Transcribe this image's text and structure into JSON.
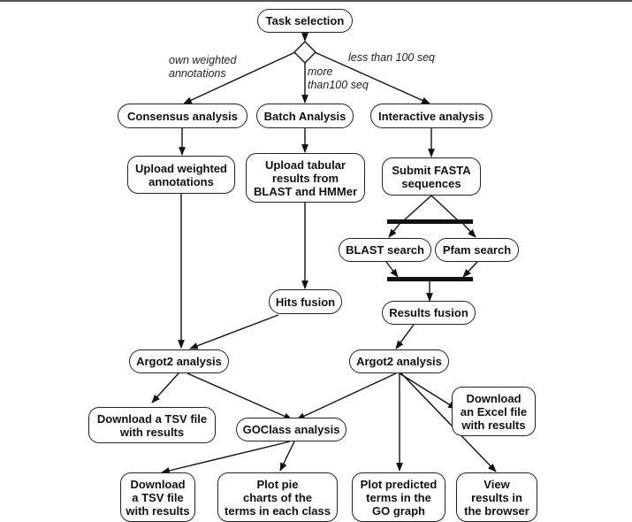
{
  "diagram": {
    "nodes": {
      "task_selection": "Task selection",
      "consensus_analysis": "Consensus analysis",
      "batch_analysis": "Batch Analysis",
      "interactive_analysis": "Interactive analysis",
      "upload_weighted": "Upload weighted\nannotations",
      "upload_tabular": "Upload tabular\nresults from\nBLAST and HMMer",
      "submit_fasta": "Submit FASTA\nsequences",
      "blast_search": "BLAST search",
      "pfam_search": "Pfam search",
      "hits_fusion": "Hits fusion",
      "results_fusion": "Results fusion",
      "argot2_left": "Argot2 analysis",
      "argot2_right": "Argot2 analysis",
      "download_tsv_left": "Download a TSV file\nwith results",
      "goclass_analysis": "GOClass analysis",
      "download_excel": "Download\nan Excel file\nwith results",
      "download_tsv_bottom": "Download\na TSV file\nwith results",
      "plot_pie": "Plot pie\ncharts of the\nterms in each class",
      "plot_go_graph": "Plot predicted\nterms in the\nGO graph",
      "view_browser": "View\nresults in\nthe browser"
    },
    "edge_labels": {
      "own_weighted": "own weighted\nannotations",
      "more_than_100": "more\nthan100 seq",
      "less_than_100": "less than 100 seq"
    }
  }
}
